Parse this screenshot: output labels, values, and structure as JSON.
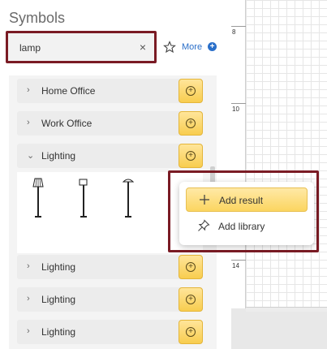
{
  "panel": {
    "title": "Symbols",
    "search": {
      "value": "lamp",
      "clear_label": "×"
    },
    "more_label": "More"
  },
  "categories": [
    {
      "label": "Home Office",
      "expanded": false
    },
    {
      "label": "Work Office",
      "expanded": false
    },
    {
      "label": "Lighting",
      "expanded": true
    },
    {
      "label": "Lighting",
      "expanded": false
    },
    {
      "label": "Lighting",
      "expanded": false
    },
    {
      "label": "Lighting",
      "expanded": false
    }
  ],
  "ruler": {
    "labels": [
      "8",
      "10",
      "14"
    ]
  },
  "popup": {
    "items": [
      {
        "label": "Add result",
        "icon": "plus-icon"
      },
      {
        "label": "Add library",
        "icon": "pin-icon"
      }
    ]
  },
  "colors": {
    "accent": "#2a6fc9",
    "highlight": "#f8cd4f",
    "frame": "#7a1b24"
  }
}
